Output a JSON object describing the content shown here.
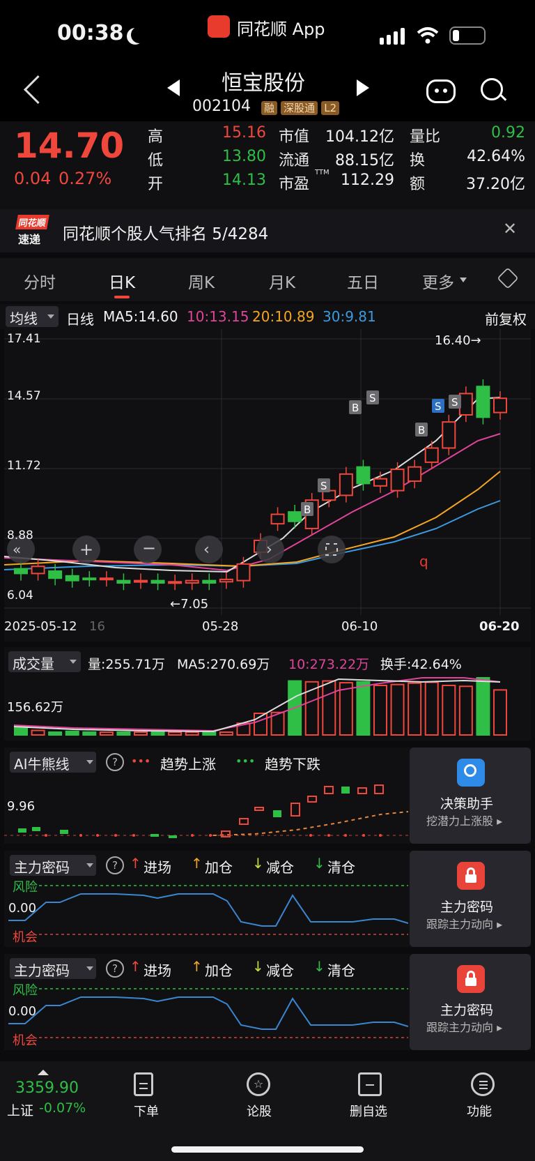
{
  "status": {
    "time": "00:38",
    "app_label": "同花顺 App"
  },
  "stock": {
    "name": "恒宝股份",
    "code": "002104",
    "tags": [
      "融",
      "深股通",
      "L2"
    ],
    "price": "14.70",
    "change": "0.04",
    "change_pct": "0.27%"
  },
  "quote_stats": [
    {
      "label": "高",
      "value": "15.16",
      "color": "red"
    },
    {
      "label": "低",
      "value": "13.80",
      "color": "green"
    },
    {
      "label": "开",
      "value": "14.13",
      "color": "green"
    }
  ],
  "quote_stats2": [
    {
      "label": "市值",
      "value": "104.12亿"
    },
    {
      "label": "流通",
      "value": "88.15亿"
    },
    {
      "label": "市盈",
      "sup": "TTM",
      "value": "112.29"
    }
  ],
  "quote_stats3": [
    {
      "label": "量比",
      "value": "0.92",
      "color": "green"
    },
    {
      "label": "换",
      "value": "42.64%"
    },
    {
      "label": "额",
      "value": "37.20亿"
    }
  ],
  "banner": {
    "logo_top": "同花顺",
    "logo_bottom": "速递",
    "text": "同花顺个股人气排名 5/4284"
  },
  "tabs": [
    "分时",
    "日K",
    "周K",
    "月K",
    "五日",
    "更多"
  ],
  "kline_header": {
    "selector": "均线",
    "type": "日线",
    "ma5": "MA5:14.60",
    "ma10": "10:13.15",
    "ma20": "20:10.89",
    "ma30": "30:9.81",
    "adjust": "前复权"
  },
  "kline_axis": {
    "y_labels": [
      "17.41",
      "14.57",
      "11.72",
      "8.88",
      "6.04"
    ],
    "x_labels": [
      "2025-05-12",
      "16",
      "05-28",
      "06-10",
      "06-20"
    ],
    "max_label": "16.40→",
    "min_label": "←7.05"
  },
  "volume_header": {
    "selector": "成交量",
    "vol": "量:255.71万",
    "ma5": "MA5:270.69万",
    "ma10": "10:273.22万",
    "turnover": "换手:42.64%",
    "y_label": "156.62万"
  },
  "ai_header": {
    "selector": "AI牛熊线",
    "legend_up": "趋势上涨",
    "legend_down": "趋势下跌",
    "y_label": "9.96",
    "side_title": "决策助手",
    "side_sub": "挖潜力上涨股 ▸"
  },
  "mm_header": {
    "selector": "主力密码",
    "l1": "进场",
    "l2": "加仓",
    "l3": "减仓",
    "l4": "清仓",
    "risk": "风险",
    "zero": "0.00",
    "chance": "机会",
    "side_title": "主力密码",
    "side_sub": "跟踪主力动向 ▸"
  },
  "nav": {
    "index_value": "3359.90",
    "index_name": "上证",
    "index_change": "-0.07%",
    "items": [
      "下单",
      "论股",
      "删自选",
      "功能"
    ]
  },
  "chart_data": {
    "type": "candlestick",
    "ylim": [
      6.04,
      17.41
    ],
    "candles": [
      {
        "o": 7.7,
        "c": 7.5
      },
      {
        "o": 7.5,
        "c": 7.8
      },
      {
        "o": 7.6,
        "c": 7.3
      },
      {
        "o": 7.4,
        "c": 7.2
      },
      {
        "o": 7.3,
        "c": 7.25
      },
      {
        "o": 7.25,
        "c": 7.3
      },
      {
        "o": 7.2,
        "c": 7.1
      },
      {
        "o": 7.15,
        "c": 7.2
      },
      {
        "o": 7.2,
        "c": 7.1
      },
      {
        "o": 7.1,
        "c": 7.15
      },
      {
        "o": 7.1,
        "c": 7.2
      },
      {
        "o": 7.2,
        "c": 7.1
      },
      {
        "o": 7.15,
        "c": 7.25
      },
      {
        "o": 7.2,
        "c": 7.9
      },
      {
        "o": 8.4,
        "c": 8.9
      },
      {
        "o": 9.6,
        "c": 10.0
      },
      {
        "o": 10.1,
        "c": 9.7
      },
      {
        "o": 9.4,
        "c": 10.6
      },
      {
        "o": 10.6,
        "c": 11.0
      },
      {
        "o": 10.8,
        "c": 11.7
      },
      {
        "o": 12.0,
        "c": 11.3
      },
      {
        "o": 11.2,
        "c": 11.5
      },
      {
        "o": 11.0,
        "c": 11.9
      },
      {
        "o": 11.4,
        "c": 12.0
      },
      {
        "o": 12.2,
        "c": 12.8
      },
      {
        "o": 12.8,
        "c": 13.9
      },
      {
        "o": 14.2,
        "c": 15.1
      },
      {
        "o": 15.4,
        "c": 14.1
      },
      {
        "o": 14.3,
        "c": 14.9
      }
    ],
    "volume": [
      18,
      10,
      6,
      8,
      6,
      5,
      6,
      6,
      5,
      5,
      4,
      4,
      5,
      26,
      48,
      50,
      120,
      118,
      120,
      116,
      118,
      110,
      112,
      115,
      117,
      110,
      108,
      127,
      100
    ]
  }
}
